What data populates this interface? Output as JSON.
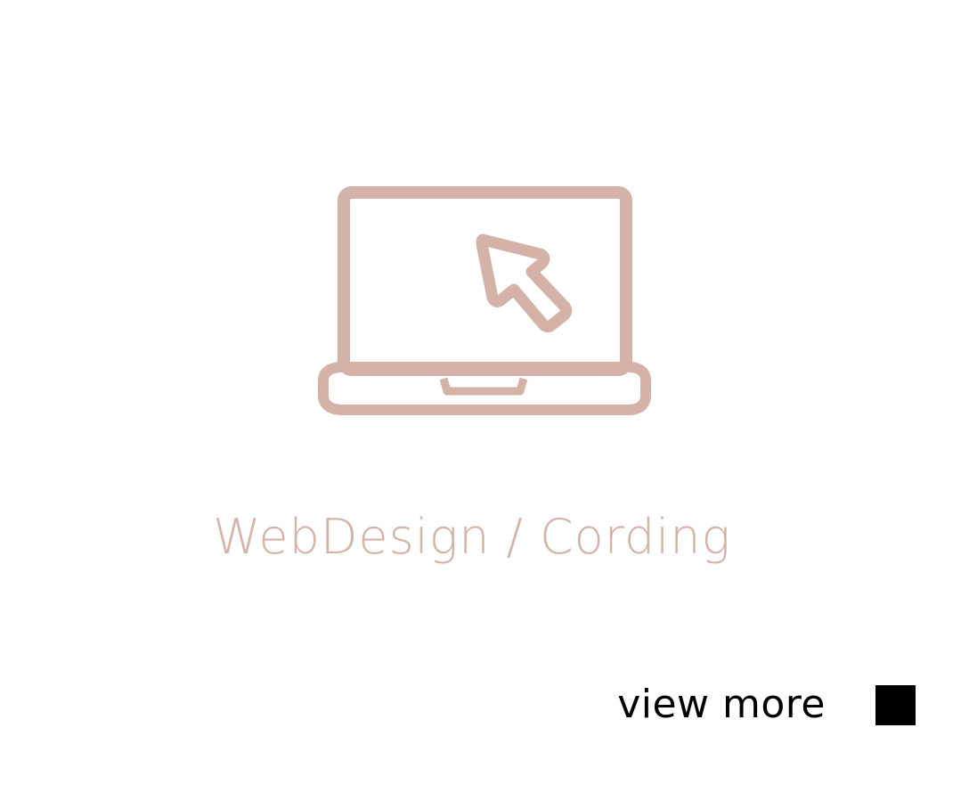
{
  "card": {
    "title": "WebDesign / Cording",
    "icon": "laptop-cursor-icon",
    "view_more_label": "view more"
  },
  "colors": {
    "accent": "#d4b2a7",
    "text_dark": "#000000",
    "background": "#ffffff"
  }
}
